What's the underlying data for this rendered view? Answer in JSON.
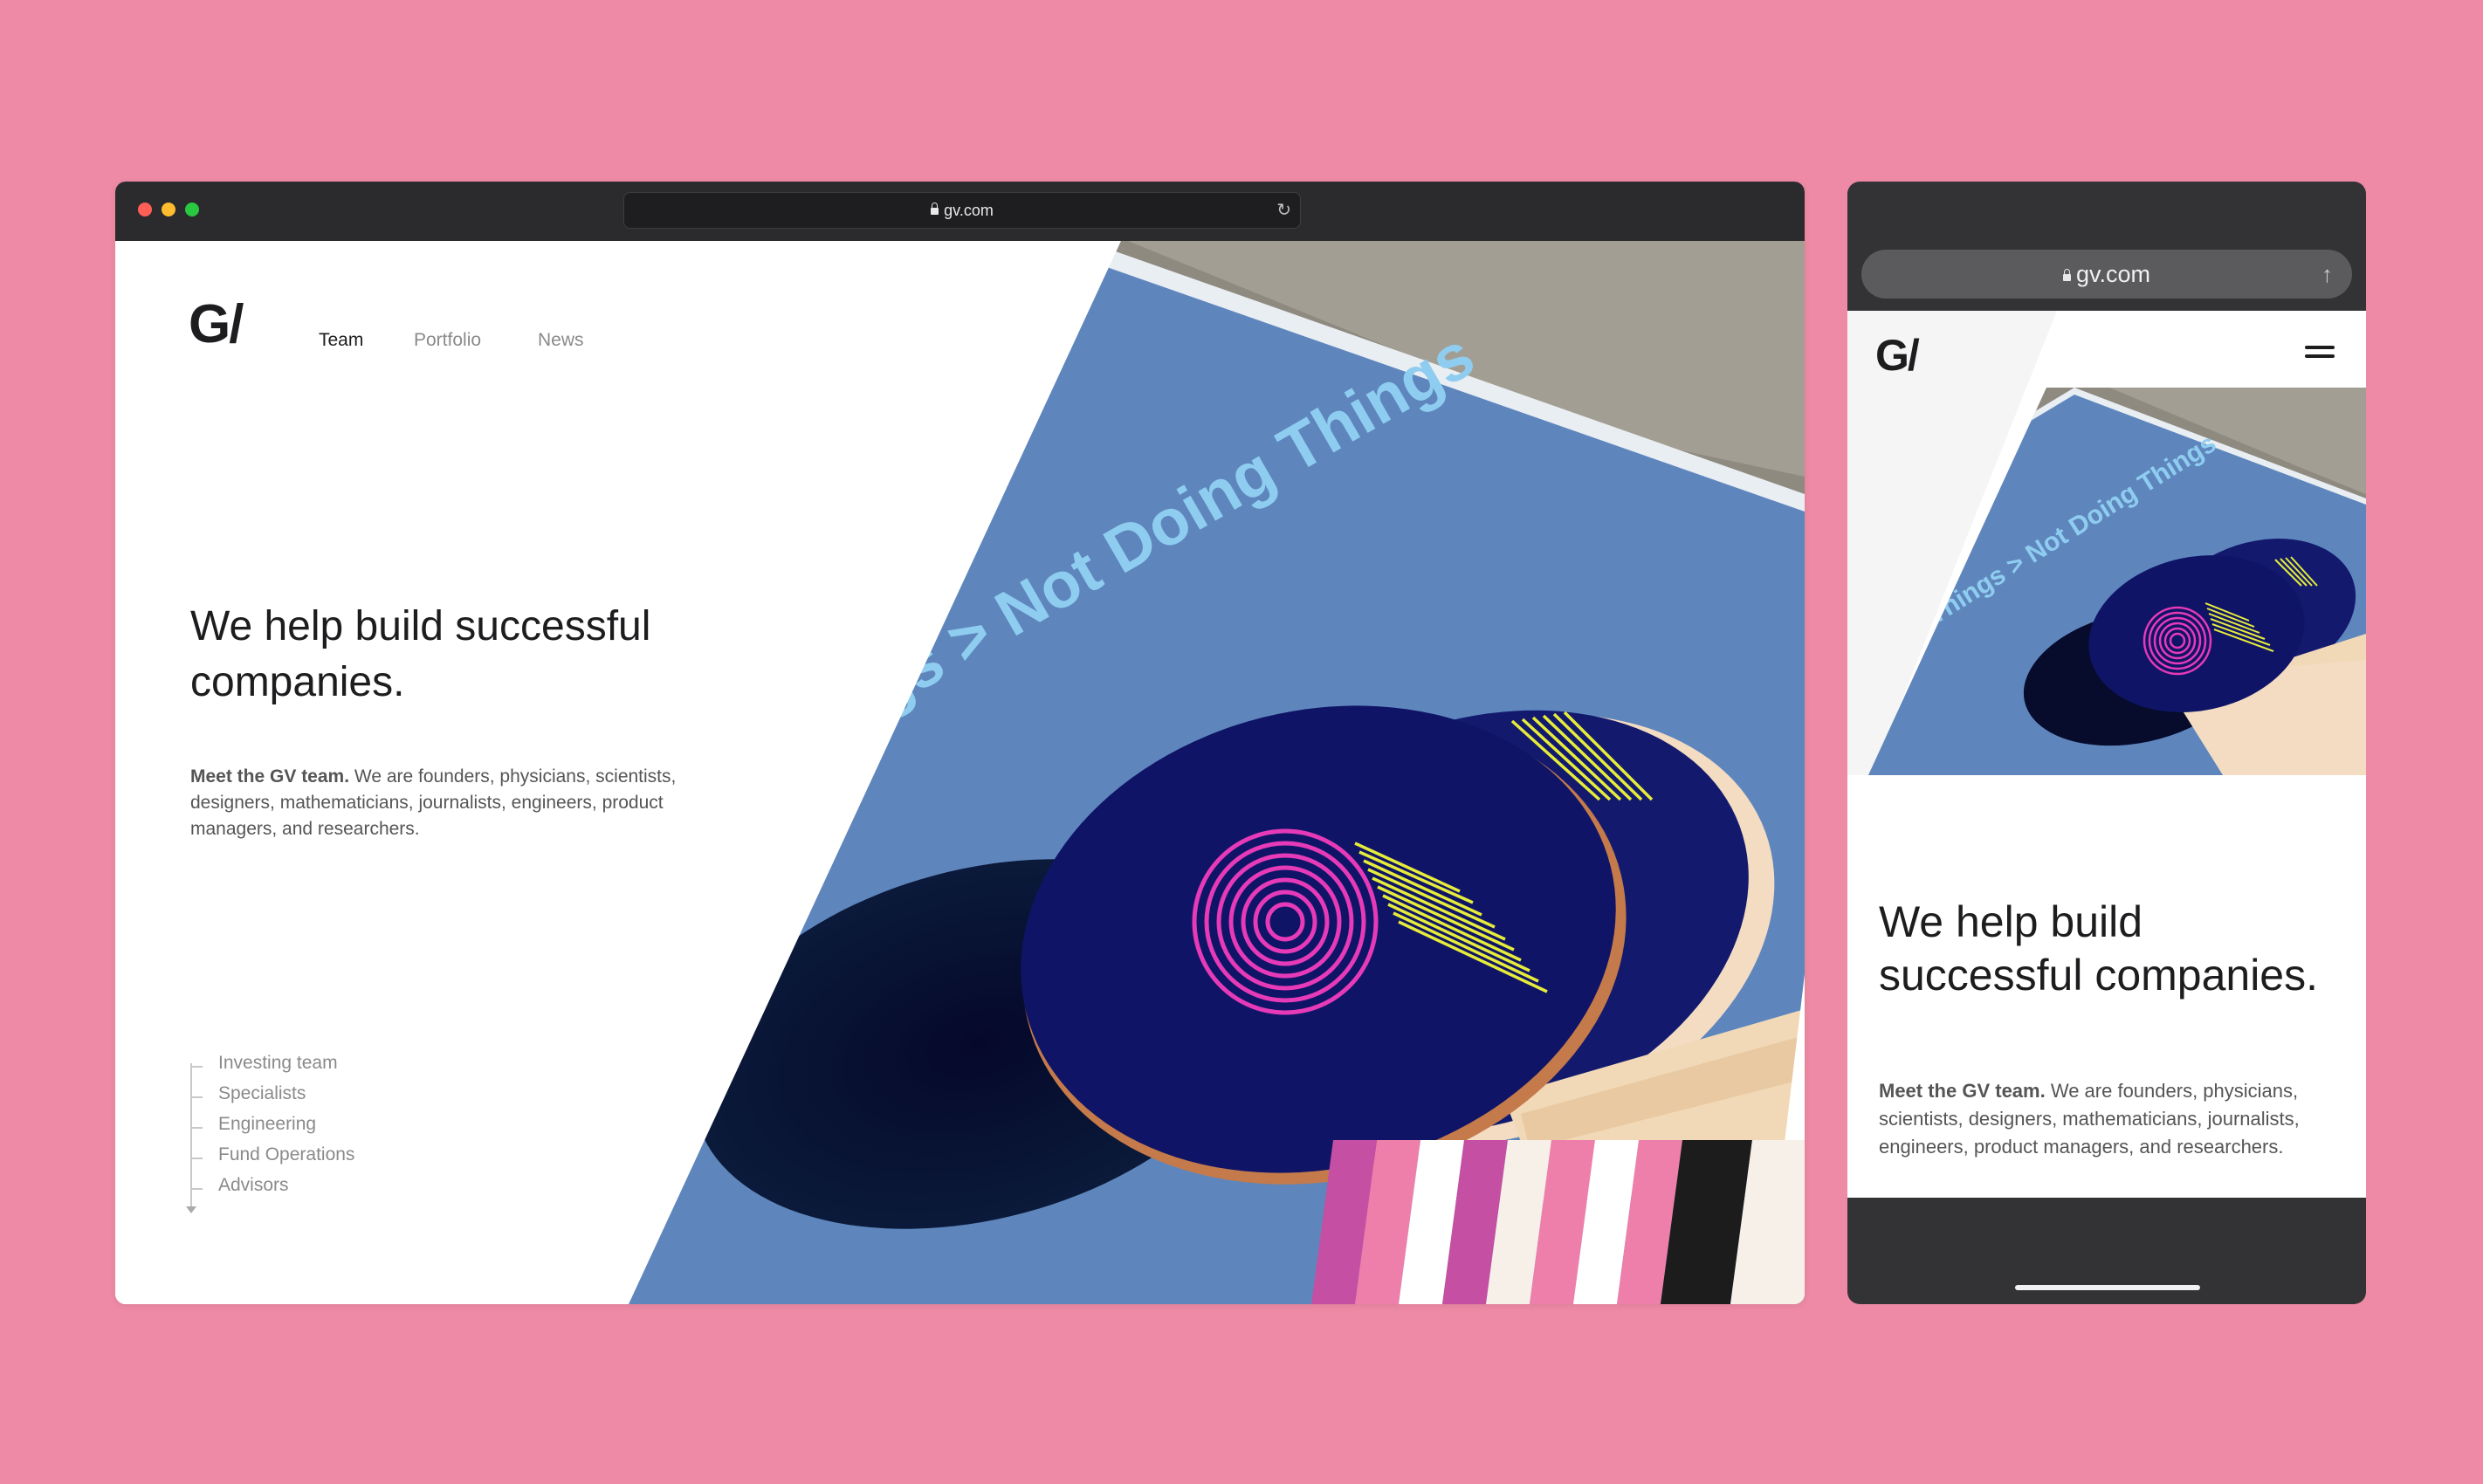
{
  "desktop": {
    "window_controls": [
      "close",
      "minimize",
      "zoom"
    ],
    "url": "gv.com",
    "reload_icon": "reload-icon",
    "logo": "G/",
    "nav": [
      {
        "label": "Team",
        "active": true
      },
      {
        "label": "Portfolio",
        "active": false
      },
      {
        "label": "News",
        "active": false
      }
    ],
    "headline": "We help build successful companies.",
    "intro_bold": "Meet the GV team.",
    "intro_rest": " We are founders, physicians, scientists, designers, mathematicians, journalists, engineers, product managers, and researchers.",
    "team_sections": [
      "Investing team",
      "Specialists",
      "Engineering",
      "Fund Operations",
      "Advisors"
    ],
    "hero_text": "gs > Not Doing Things"
  },
  "mobile": {
    "url": "gv.com",
    "share_icon": "share-icon",
    "logo": "G/",
    "menu_icon": "hamburger-menu-icon",
    "headline": "We help build successful companies.",
    "intro_bold": "Meet the GV team.",
    "intro_rest": " We are founders, physicians, scientists, designers, mathematicians, journalists, engineers, product managers, and researchers.",
    "hero_text": "Things > Not Doing Things"
  },
  "colors": {
    "background": "#ee8aa5",
    "chrome": "#2b2b2e",
    "table_blue": "#5e86bd",
    "paddle_navy": "#0f1466",
    "paddle_pink": "#e63ab8",
    "paddle_yellow": "#e6ec3a",
    "stripe_magenta": "#c44fa3",
    "stripe_pink": "#ee7faa",
    "stripe_cream": "#f6f0e8",
    "stripe_black": "#1c1c1c"
  }
}
